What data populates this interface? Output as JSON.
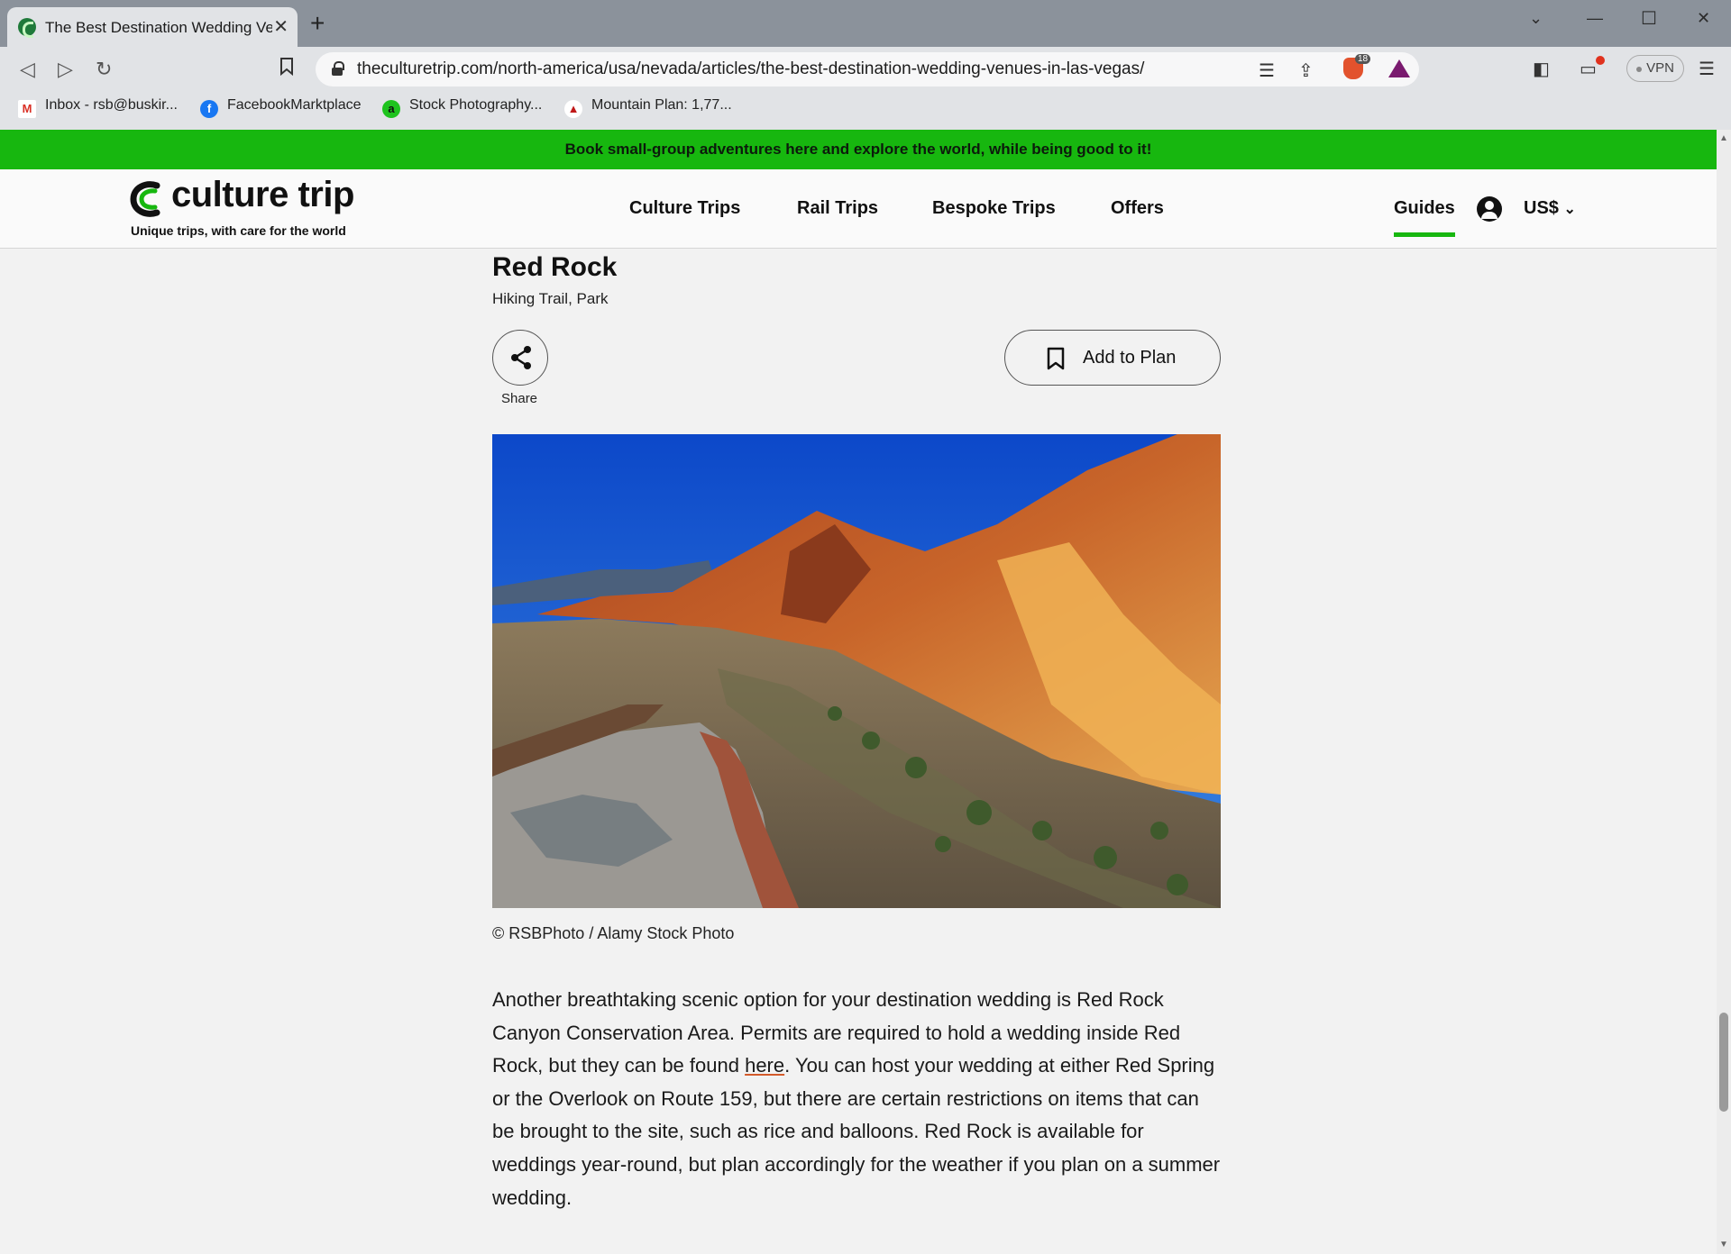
{
  "browser": {
    "tab_title": "The Best Destination Wedding Venues in Las Vegas",
    "url": "theculturetrip.com/north-america/usa/nevada/articles/the-best-destination-wedding-venues-in-las-vegas/",
    "brave_shield_count": "18",
    "vpn_label": "VPN",
    "bookmarks": [
      {
        "label": "Inbox - rsb@buskir...",
        "icon": "gmail-icon"
      },
      {
        "label": "FacebookMarktplace",
        "icon": "facebook-icon"
      },
      {
        "label": "Stock Photography...",
        "icon": "alamy-icon"
      },
      {
        "label": "Mountain Plan: 1,77...",
        "icon": "mountain-icon"
      }
    ]
  },
  "banner": {
    "text": "Book small-group adventures here and explore the world, while being good to it!"
  },
  "header": {
    "logo_text": "culture trip",
    "tagline": "Unique trips, with care for the world",
    "nav": [
      "Culture Trips",
      "Rail Trips",
      "Bespoke Trips",
      "Offers"
    ],
    "guides": "Guides",
    "currency": "US$"
  },
  "venue": {
    "title": "Red Rock",
    "type": "Hiking Trail, Park",
    "share_label": "Share",
    "add_to_plan": "Add to Plan",
    "photo_credit": "© RSBPhoto / Alamy Stock Photo",
    "body_pre": "Another breathtaking scenic option for your destination wedding is Red Rock Canyon Conservation Area. Permits are required to hold a wedding inside Red Rock, but they can be found ",
    "body_link": "here",
    "body_post": ". You can host your wedding at either Red Spring or the Overlook on Route 159, but there are certain restrictions on items that can be brought to the site, such as rice and balloons. Red Rock is available for weddings year-round, but plan accordingly for the weather if you plan on a summer wedding."
  },
  "colors": {
    "brand_green": "#17b70f",
    "link_underline": "#d35a2a"
  }
}
